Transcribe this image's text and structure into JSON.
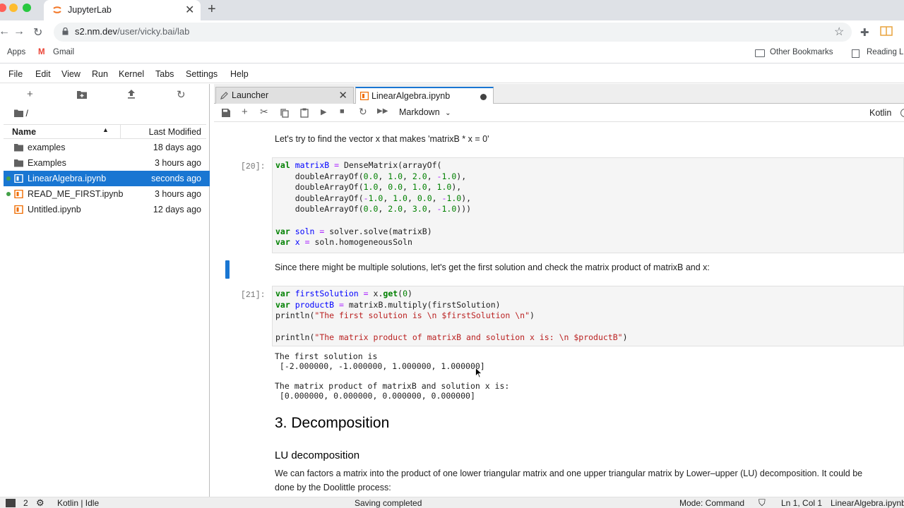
{
  "browser": {
    "tab_title": "JupyterLab",
    "new_tab_glyph": "+",
    "url_host": "s2.nm.dev",
    "url_path": "/user/vicky.bai/lab",
    "bookmarks": {
      "apps": "Apps",
      "gmail": "Gmail",
      "other": "Other Bookmarks",
      "reading": "Reading L"
    }
  },
  "menubar": [
    "File",
    "Edit",
    "View",
    "Run",
    "Kernel",
    "Tabs",
    "Settings",
    "Help"
  ],
  "filebrowser": {
    "breadcrumb": "/",
    "col_name": "Name",
    "col_modified": "Last Modified",
    "items": [
      {
        "name": "examples",
        "modified": "18 days ago",
        "type": "folder"
      },
      {
        "name": "Examples",
        "modified": "3 hours ago",
        "type": "folder"
      },
      {
        "name": "LinearAlgebra.ipynb",
        "modified": "seconds ago",
        "type": "notebook",
        "selected": true,
        "running": true
      },
      {
        "name": "READ_ME_FIRST.ipynb",
        "modified": "3 hours ago",
        "type": "notebook",
        "running": true
      },
      {
        "name": "Untitled.ipynb",
        "modified": "12 days ago",
        "type": "notebook"
      }
    ]
  },
  "dock": {
    "tabs": [
      {
        "label": "Launcher"
      },
      {
        "label": "LinearAlgebra.ipynb"
      }
    ]
  },
  "nb_toolbar": {
    "cell_type": "Markdown",
    "kernel": "Kotlin"
  },
  "notebook": {
    "md1": "Let's try to find the vector x that makes 'matrixB * x = 0'",
    "prompt20": "[20]:",
    "md2": "Since there might be multiple solutions, let's get the first solution and check the matrix product of matrixB and x:",
    "prompt21": "[21]:",
    "out1_l1": "The first solution is",
    "out1_l2": " [-2.000000, -1.000000, 1.000000, 1.000000]",
    "out2_l1": "The matrix product of matrixB and solution x is:",
    "out2_l2": " [0.000000, 0.000000, 0.000000, 0.000000]",
    "h_decomp": "3. Decomposition",
    "h_lu": "LU decomposition",
    "para_lu": "We can factors a matrix into the product of one lower triangular matrix and one upper triangular matrix by Lower–upper (LU) decomposition. It could be done by the Doolittle process:"
  },
  "statusbar": {
    "terminals": "2",
    "kernel_status": "Kotlin | Idle",
    "saving": "Saving completed",
    "mode": "Mode: Command",
    "position": "Ln 1, Col 1",
    "filename": "LinearAlgebra.ipynb"
  },
  "colors": {
    "accent": "#1976d2",
    "selected_row": "#1976d2",
    "running_dot": "#43a047"
  }
}
